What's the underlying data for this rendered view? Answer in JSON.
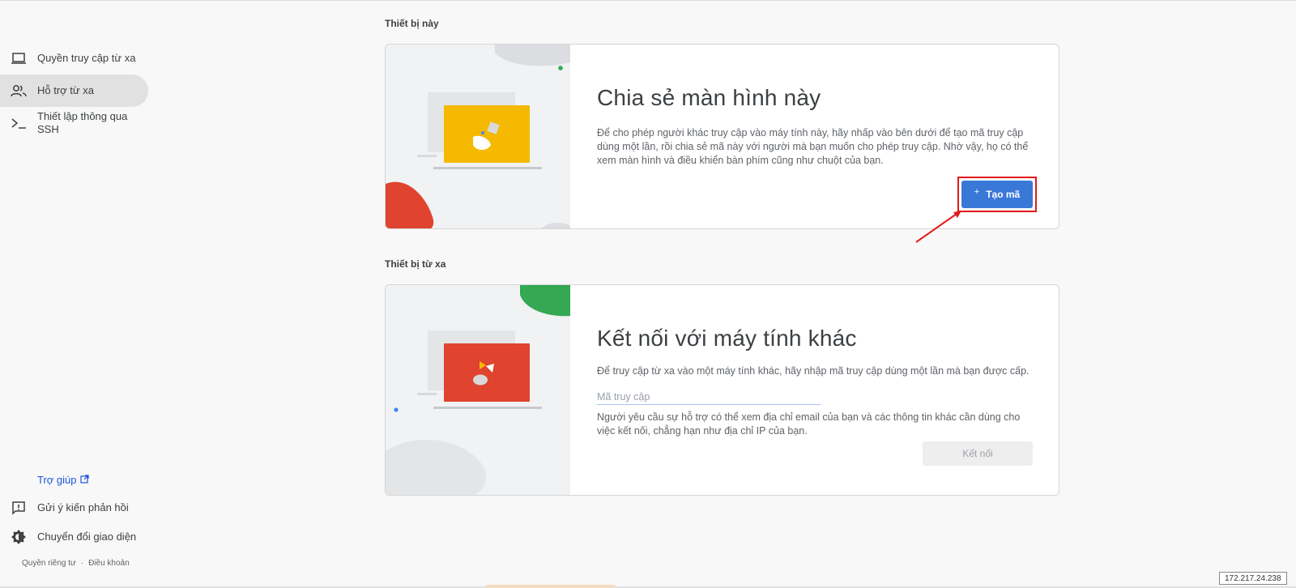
{
  "sidebar": {
    "items": [
      {
        "label": "Quyền truy cập từ xa",
        "icon": "laptop-icon"
      },
      {
        "label": "Hỗ trợ từ xa",
        "icon": "people-icon",
        "active": true
      },
      {
        "label": "Thiết lập thông qua SSH",
        "icon": "terminal-icon"
      }
    ],
    "help": "Trợ giúp",
    "feedback": "Gửi ý kiến phản hồi",
    "theme": "Chuyển đổi giao diện",
    "privacy": "Quyền riêng tư",
    "separator": "·",
    "terms": "Điều khoản"
  },
  "this_device": {
    "section_title": "Thiết bị này",
    "heading": "Chia sẻ màn hình này",
    "description": "Để cho phép người khác truy cập vào máy tính này, hãy nhấp vào bên dưới để tạo mã truy cập dùng một lần, rồi chia sẻ mã này với người mà bạn muốn cho phép truy cập. Nhờ vậy, họ có thể xem màn hình và điều khiển bàn phím cũng như chuột của bạn.",
    "create_button": "Tạo mã",
    "create_icon": "plus-icon"
  },
  "remote_device": {
    "section_title": "Thiết bị từ xa",
    "heading": "Kết nối với máy tính khác",
    "description": "Để truy cập từ xa vào một máy tính khác, hãy nhập mã truy cập dùng một lần mà bạn được cấp.",
    "input_placeholder": "Mã truy cập",
    "input_value": "",
    "note": "Người yêu cầu sự hỗ trợ có thể xem địa chỉ email của bạn và các thông tin khác cần dùng cho việc kết nối, chẳng hạn như địa chỉ IP của bạn.",
    "connect_button": "Kết nối"
  },
  "ip_address": "172.217.24.238",
  "colors": {
    "accent": "#3a78d8",
    "highlight": "#e01b1b",
    "yellow": "#f4b900",
    "red": "#e0432f",
    "green": "#34a853"
  }
}
